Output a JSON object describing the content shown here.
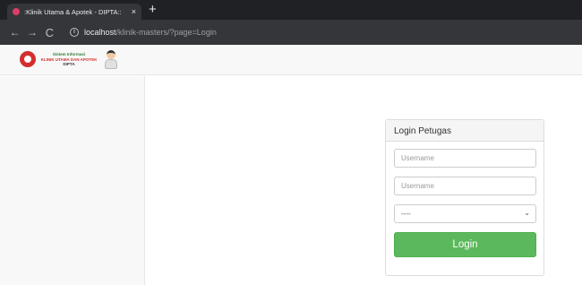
{
  "browser": {
    "tab_title": ":Klinik Utama & Apotek - DIPTA::",
    "tab_close": "×",
    "new_tab": "+",
    "back": "←",
    "forward": "→",
    "reload": "C",
    "url_host": "localhost",
    "url_path": "/klinik-masters/?page=Login"
  },
  "header": {
    "brand_line1": "Sistem Informasi",
    "brand_line2": "KLINIK UTAMA DAN APOTEK",
    "brand_line3": "DIPTA"
  },
  "login": {
    "heading": "Login Petugas",
    "username_placeholder": "Username",
    "password_placeholder": "Username",
    "role_selected": "----",
    "submit_label": "Login"
  },
  "colors": {
    "login_button": "#5cb85c",
    "browser_chrome": "#202124",
    "sidebar": "#f8f8f8"
  }
}
